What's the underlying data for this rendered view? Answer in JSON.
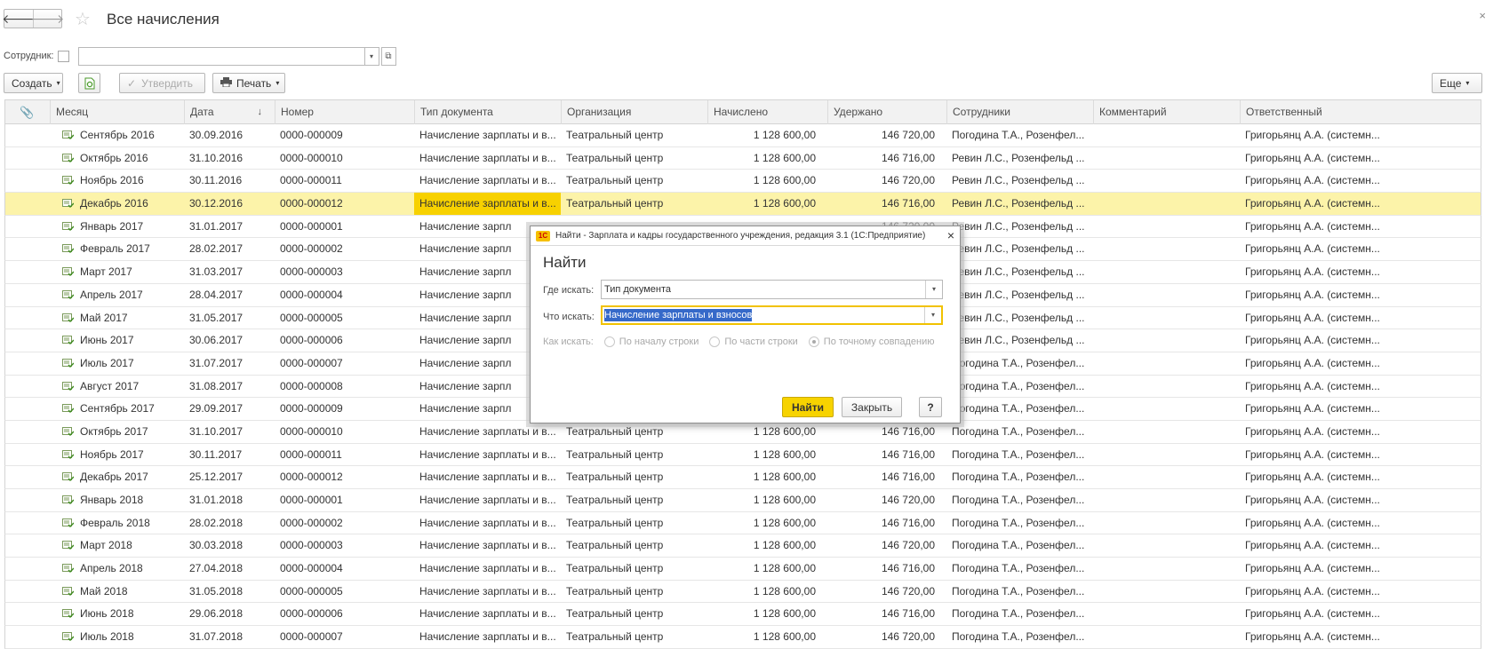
{
  "window": {
    "title": "Все начисления",
    "close": "×"
  },
  "nav": {
    "back": "🡐",
    "forward": "🡒",
    "favorite": "☆"
  },
  "filter": {
    "label": "Сотрудник:",
    "value": "",
    "dropdown": "▾",
    "open": "⧉"
  },
  "toolbar": {
    "create": "Создать",
    "approve": "Утвердить",
    "print": "Печать",
    "more": "Еще"
  },
  "table": {
    "columns": [
      "",
      "Месяц",
      "Дата",
      "Номер",
      "Тип документа",
      "Организация",
      "Начислено",
      "Удержано",
      "Сотрудники",
      "Комментарий",
      "Ответственный"
    ],
    "sort_indicator": "↓",
    "rows": [
      [
        "Сентябрь 2016",
        "30.09.2016",
        "0000-000009",
        "Начисление зарплаты и в...",
        "Театральный центр",
        "1 128 600,00",
        "146 720,00",
        "Погодина Т.А., Розенфел...",
        "",
        "Григорьянц А.А. (системн..."
      ],
      [
        "Октябрь 2016",
        "31.10.2016",
        "0000-000010",
        "Начисление зарплаты и в...",
        "Театральный центр",
        "1 128 600,00",
        "146 716,00",
        "Ревин Л.С., Розенфельд ...",
        "",
        "Григорьянц А.А. (системн..."
      ],
      [
        "Ноябрь 2016",
        "30.11.2016",
        "0000-000011",
        "Начисление зарплаты и в...",
        "Театральный центр",
        "1 128 600,00",
        "146 720,00",
        "Ревин Л.С., Розенфельд ...",
        "",
        "Григорьянц А.А. (системн..."
      ],
      [
        "Декабрь 2016",
        "30.12.2016",
        "0000-000012",
        "Начисление зарплаты и в...",
        "Театральный центр",
        "1 128 600,00",
        "146 716,00",
        "Ревин Л.С., Розенфельд ...",
        "",
        "Григорьянц А.А. (системн..."
      ],
      [
        "Январь 2017",
        "31.01.2017",
        "0000-000001",
        "Начисление зарпл",
        "",
        "",
        "146 720,00",
        "Ревин Л.С., Розенфельд ...",
        "",
        "Григорьянц А.А. (системн..."
      ],
      [
        "Февраль 2017",
        "28.02.2017",
        "0000-000002",
        "Начисление зарпл",
        "",
        "",
        "146 716,00",
        "Ревин Л.С., Розенфельд ...",
        "",
        "Григорьянц А.А. (системн..."
      ],
      [
        "Март 2017",
        "31.03.2017",
        "0000-000003",
        "Начисление зарпл",
        "",
        "",
        "146 720,00",
        "Ревин Л.С., Розенфельд ...",
        "",
        "Григорьянц А.А. (системн..."
      ],
      [
        "Апрель 2017",
        "28.04.2017",
        "0000-000004",
        "Начисление зарпл",
        "",
        "",
        "146 716,00",
        "Ревин Л.С., Розенфельд ...",
        "",
        "Григорьянц А.А. (системн..."
      ],
      [
        "Май 2017",
        "31.05.2017",
        "0000-000005",
        "Начисление зарпл",
        "",
        "",
        "146 720,00",
        "Ревин Л.С., Розенфельд ...",
        "",
        "Григорьянц А.А. (системн..."
      ],
      [
        "Июнь 2017",
        "30.06.2017",
        "0000-000006",
        "Начисление зарпл",
        "",
        "",
        "146 716,00",
        "Ревин Л.С., Розенфельд ...",
        "",
        "Григорьянц А.А. (системн..."
      ],
      [
        "Июль 2017",
        "31.07.2017",
        "0000-000007",
        "Начисление зарпл",
        "",
        "",
        "146 720,00",
        "Погодина Т.А., Розенфел...",
        "",
        "Григорьянц А.А. (системн..."
      ],
      [
        "Август 2017",
        "31.08.2017",
        "0000-000008",
        "Начисление зарпл",
        "",
        "",
        "146 716,00",
        "Погодина Т.А., Розенфел...",
        "",
        "Григорьянц А.А. (системн..."
      ],
      [
        "Сентябрь 2017",
        "29.09.2017",
        "0000-000009",
        "Начисление зарпл",
        "",
        "",
        "146 720,00",
        "Погодина Т.А., Розенфел...",
        "",
        "Григорьянц А.А. (системн..."
      ],
      [
        "Октябрь 2017",
        "31.10.2017",
        "0000-000010",
        "Начисление зарплаты и в...",
        "Театральный центр",
        "1 128 600,00",
        "146 716,00",
        "Погодина Т.А., Розенфел...",
        "",
        "Григорьянц А.А. (системн..."
      ],
      [
        "Ноябрь 2017",
        "30.11.2017",
        "0000-000011",
        "Начисление зарплаты и в...",
        "Театральный центр",
        "1 128 600,00",
        "146 716,00",
        "Погодина Т.А., Розенфел...",
        "",
        "Григорьянц А.А. (системн..."
      ],
      [
        "Декабрь 2017",
        "25.12.2017",
        "0000-000012",
        "Начисление зарплаты и в...",
        "Театральный центр",
        "1 128 600,00",
        "146 716,00",
        "Погодина Т.А., Розенфел...",
        "",
        "Григорьянц А.А. (системн..."
      ],
      [
        "Январь 2018",
        "31.01.2018",
        "0000-000001",
        "Начисление зарплаты и в...",
        "Театральный центр",
        "1 128 600,00",
        "146 720,00",
        "Погодина Т.А., Розенфел...",
        "",
        "Григорьянц А.А. (системн..."
      ],
      [
        "Февраль 2018",
        "28.02.2018",
        "0000-000002",
        "Начисление зарплаты и в...",
        "Театральный центр",
        "1 128 600,00",
        "146 716,00",
        "Погодина Т.А., Розенфел...",
        "",
        "Григорьянц А.А. (системн..."
      ],
      [
        "Март 2018",
        "30.03.2018",
        "0000-000003",
        "Начисление зарплаты и в...",
        "Театральный центр",
        "1 128 600,00",
        "146 720,00",
        "Погодина Т.А., Розенфел...",
        "",
        "Григорьянц А.А. (системн..."
      ],
      [
        "Апрель 2018",
        "27.04.2018",
        "0000-000004",
        "Начисление зарплаты и в...",
        "Театральный центр",
        "1 128 600,00",
        "146 716,00",
        "Погодина Т.А., Розенфел...",
        "",
        "Григорьянц А.А. (системн..."
      ],
      [
        "Май 2018",
        "31.05.2018",
        "0000-000005",
        "Начисление зарплаты и в...",
        "Театральный центр",
        "1 128 600,00",
        "146 720,00",
        "Погодина Т.А., Розенфел...",
        "",
        "Григорьянц А.А. (системн..."
      ],
      [
        "Июнь 2018",
        "29.06.2018",
        "0000-000006",
        "Начисление зарплаты и в...",
        "Театральный центр",
        "1 128 600,00",
        "146 716,00",
        "Погодина Т.А., Розенфел...",
        "",
        "Григорьянц А.А. (системн..."
      ],
      [
        "Июль 2018",
        "31.07.2018",
        "0000-000007",
        "Начисление зарплаты и в...",
        "Театральный центр",
        "1 128 600,00",
        "146 720,00",
        "Погодина Т.А., Розенфел...",
        "",
        "Григорьянц А.А. (системн..."
      ]
    ],
    "selected_row": 3,
    "focused_column": 4
  },
  "dialog": {
    "caption": "Найти - Зарплата и кадры государственного учреждения, редакция 3.1  (1С:Предприятие)",
    "logo": "1С",
    "title": "Найти",
    "where_label": "Где искать:",
    "where_value": "Тип документа",
    "what_label": "Что искать:",
    "what_value": "Начисление зарплаты и взносов",
    "how_label": "Как искать:",
    "options": [
      "По началу строки",
      "По части строки",
      "По точному совпадению"
    ],
    "selected_option": 2,
    "find": "Найти",
    "close": "Закрыть",
    "help": "?",
    "close_icon": "×"
  },
  "colors": {
    "selected_row": "#fcf3a9",
    "focused_cell": "#f7d100",
    "accent": "#f7d300",
    "text_highlight": "#3569c9"
  }
}
